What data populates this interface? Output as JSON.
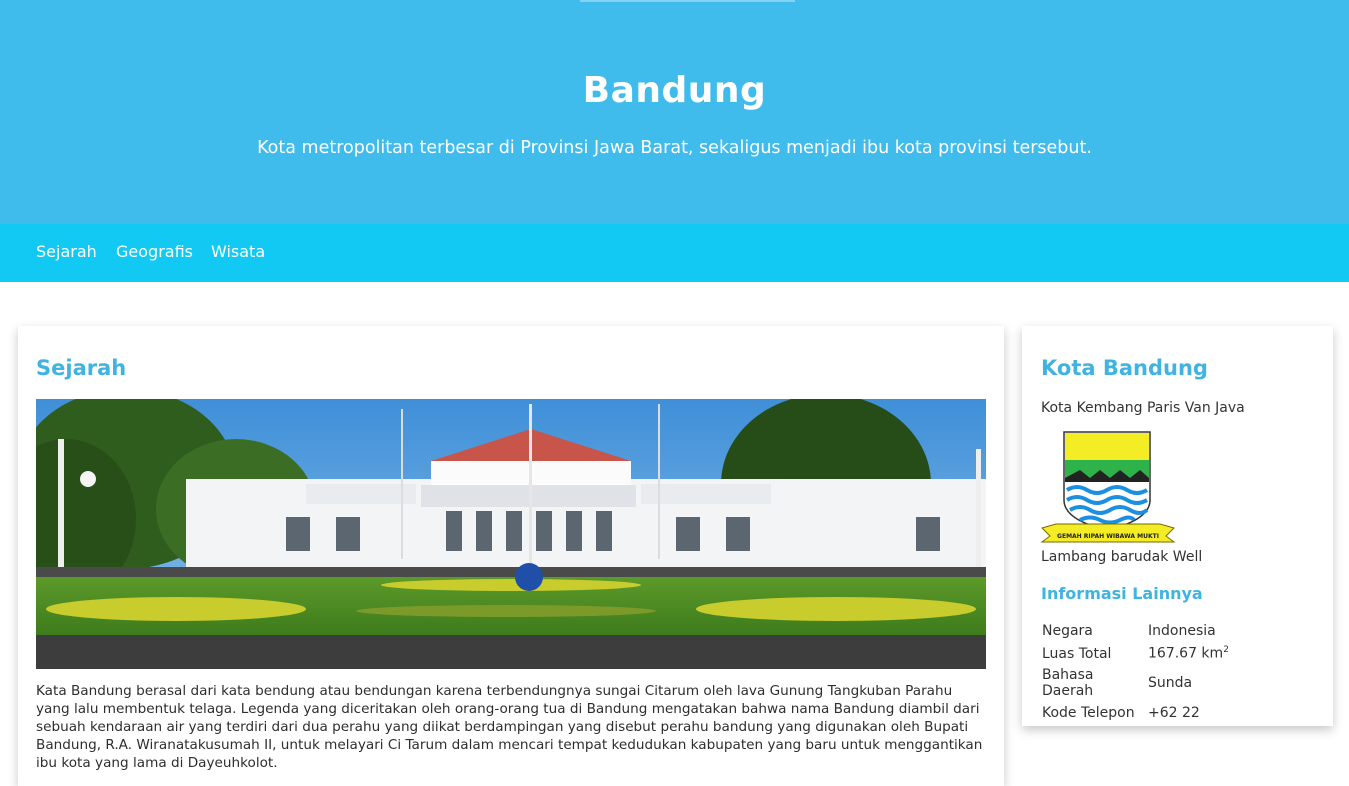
{
  "hero": {
    "title": "Bandung",
    "subtitle": "Kota metropolitan terbesar di Provinsi Jawa Barat, sekaligus menjadi ibu kota provinsi tersebut."
  },
  "nav": {
    "items": [
      {
        "label": "Sejarah"
      },
      {
        "label": "Geografis"
      },
      {
        "label": "Wisata"
      }
    ]
  },
  "main": {
    "heading": "Sejarah",
    "image_alt": "Gedung Pakuan",
    "paragraph": "Kata Bandung berasal dari kata bendung atau bendungan karena terbendungnya sungai Citarum oleh lava Gunung Tangkuban Parahu yang lalu membentuk telaga. Legenda yang diceritakan oleh orang-orang tua di Bandung mengatakan bahwa nama Bandung diambil dari sebuah kendaraan air yang terdiri dari dua perahu yang diikat berdampingan yang disebut perahu bandung yang digunakan oleh Bupati Bandung, R.A. Wiranatakusumah II, untuk melayari Ci Tarum dalam mencari tempat kedudukan kabupaten yang baru untuk menggantikan ibu kota yang lama di Dayeuhkolot."
  },
  "sidebar": {
    "heading": "Kota Bandung",
    "subtitle": "Kota Kembang Paris Van Java",
    "logo_motto": "GEMAH RIPAH WIBAWA MUKTI",
    "caption": "Lambang barudak Well",
    "info_heading": "Informasi Lainnya",
    "info": [
      {
        "key": "Negara",
        "value": "Indonesia"
      },
      {
        "key": "Luas Total",
        "value": "167.67 km",
        "sup": "2"
      },
      {
        "key": "Bahasa Daerah",
        "value": "Sunda"
      },
      {
        "key": "Kode Telepon",
        "value": "+62 22"
      }
    ]
  },
  "colors": {
    "hero_bg": "#3fbbec",
    "nav_bg": "#12c9f3",
    "accent": "#3fb3e2"
  }
}
